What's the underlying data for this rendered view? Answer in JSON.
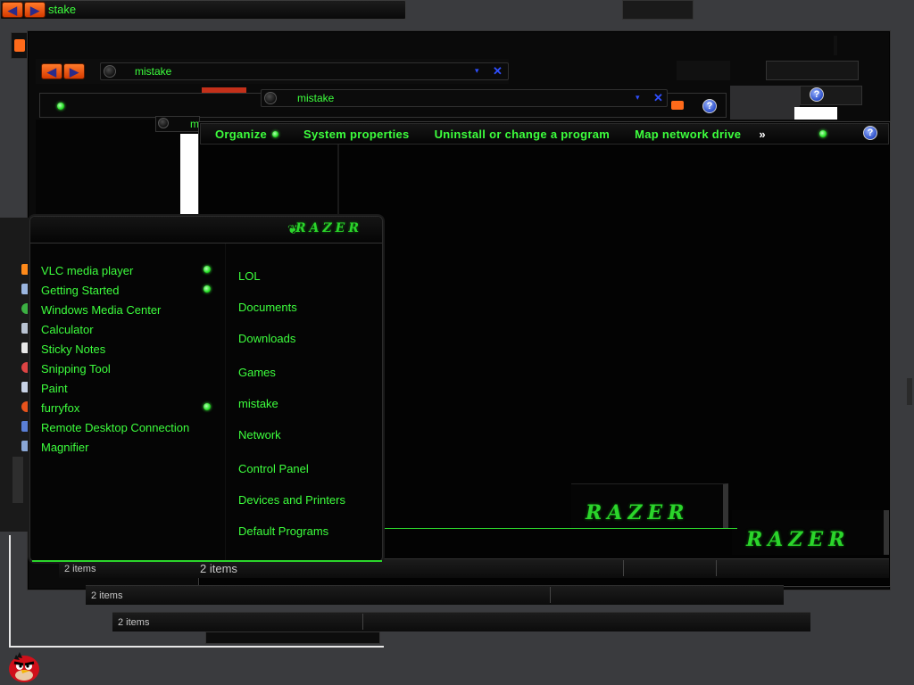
{
  "windows": {
    "back": {
      "title": "stake",
      "status": "2 items"
    },
    "middle": {
      "title": "mistake",
      "status": "2 items"
    },
    "front": {
      "title": "mistake",
      "status": "2 items",
      "partial_title": "m"
    }
  },
  "command_bar": {
    "items": [
      "Organize",
      "System properties",
      "Uninstall or change a program",
      "Map network drive"
    ],
    "overflow": "»",
    "help": "?"
  },
  "start_menu": {
    "brand": "RAZER",
    "programs": [
      "VLC media player",
      "Getting Started",
      "Windows Media Center",
      "Calculator",
      "Sticky Notes",
      "Snipping Tool",
      "Paint",
      "furryfox",
      "Remote Desktop Connection",
      "Magnifier"
    ],
    "places": [
      "LOL",
      "Documents",
      "Downloads",
      "Games",
      "mistake",
      "Network",
      "Control Panel",
      "Devices and Printers",
      "Default Programs"
    ]
  },
  "branding": {
    "logo_text": "RAZER",
    "footer_text": "RAZER"
  },
  "colors": {
    "accent": "#3dff3d",
    "nav_button": "#ff6a1a",
    "close": "#2f4fff",
    "background": "#3a3b3e"
  },
  "icons": {
    "back": "◀",
    "forward": "▶",
    "close": "✕",
    "dropdown": "▾",
    "help": "?"
  }
}
